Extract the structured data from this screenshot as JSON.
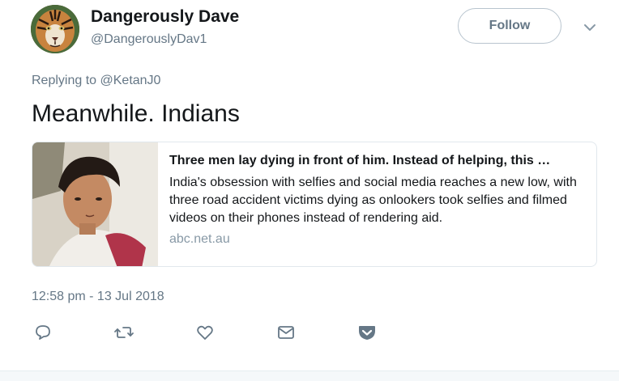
{
  "author": {
    "display_name": "Dangerously Dave",
    "handle": "@DangerouslyDav1",
    "avatar_icon": "tiger-avatar"
  },
  "header": {
    "follow_label": "Follow",
    "more_icon": "chevron-down-icon"
  },
  "reply": {
    "prefix": "Replying to ",
    "mention": "@KetanJ0"
  },
  "tweet": {
    "text": "Meanwhile. Indians",
    "timestamp": "12:58 pm - 13 Jul 2018"
  },
  "card": {
    "title": "Three men lay dying in front of him. Instead of helping, this …",
    "description": "India's obsession with selfies and social media reaches a new low, with three road accident victims dying as onlookers took selfies and filmed videos on their phones instead of rendering aid.",
    "domain": "abc.net.au"
  },
  "actions": {
    "icons": [
      "reply-icon",
      "retweet-icon",
      "like-icon",
      "direct-message-icon",
      "pocket-icon"
    ]
  },
  "colors": {
    "text_primary": "#14171a",
    "text_secondary": "#657786",
    "border": "#e1e8ed",
    "domain": "#8899a6"
  }
}
